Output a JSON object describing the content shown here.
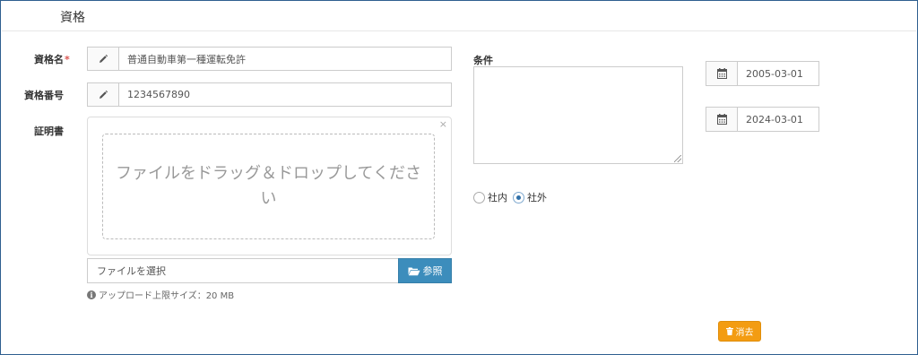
{
  "section": {
    "title": "資格"
  },
  "form": {
    "qualification_name": {
      "label": "資格名",
      "required_mark": "*",
      "value": "普通自動車第一種運転免許",
      "icon": "pencil-icon"
    },
    "qualification_number": {
      "label": "資格番号",
      "value": "1234567890",
      "icon": "pencil-icon"
    },
    "certificate": {
      "label": "証明書",
      "close_mark": "×",
      "dropzone_text": "ファイルをドラッグ＆ドロップしてください",
      "file_placeholder": "ファイルを選択",
      "browse_label": "参照",
      "browse_icon": "folder-open-icon",
      "upload_limit_note": "アップロード上限サイズ：20 MB",
      "info_icon": "info-circle-icon"
    },
    "conditions": {
      "label": "条件",
      "value": ""
    },
    "date_start": {
      "value": "2005-03-01",
      "icon": "calendar-icon"
    },
    "date_end": {
      "value": "2024-03-01",
      "icon": "calendar-icon"
    },
    "scope": {
      "options": [
        {
          "label": "社内",
          "checked": false
        },
        {
          "label": "社外",
          "checked": true
        }
      ]
    },
    "delete_button": {
      "label": "消去",
      "icon": "trash-icon"
    }
  },
  "colors": {
    "frame_border": "#2f5f8f",
    "required": "#d9534f",
    "primary_button": "#3c8dbc",
    "warning_button": "#f39c12"
  }
}
